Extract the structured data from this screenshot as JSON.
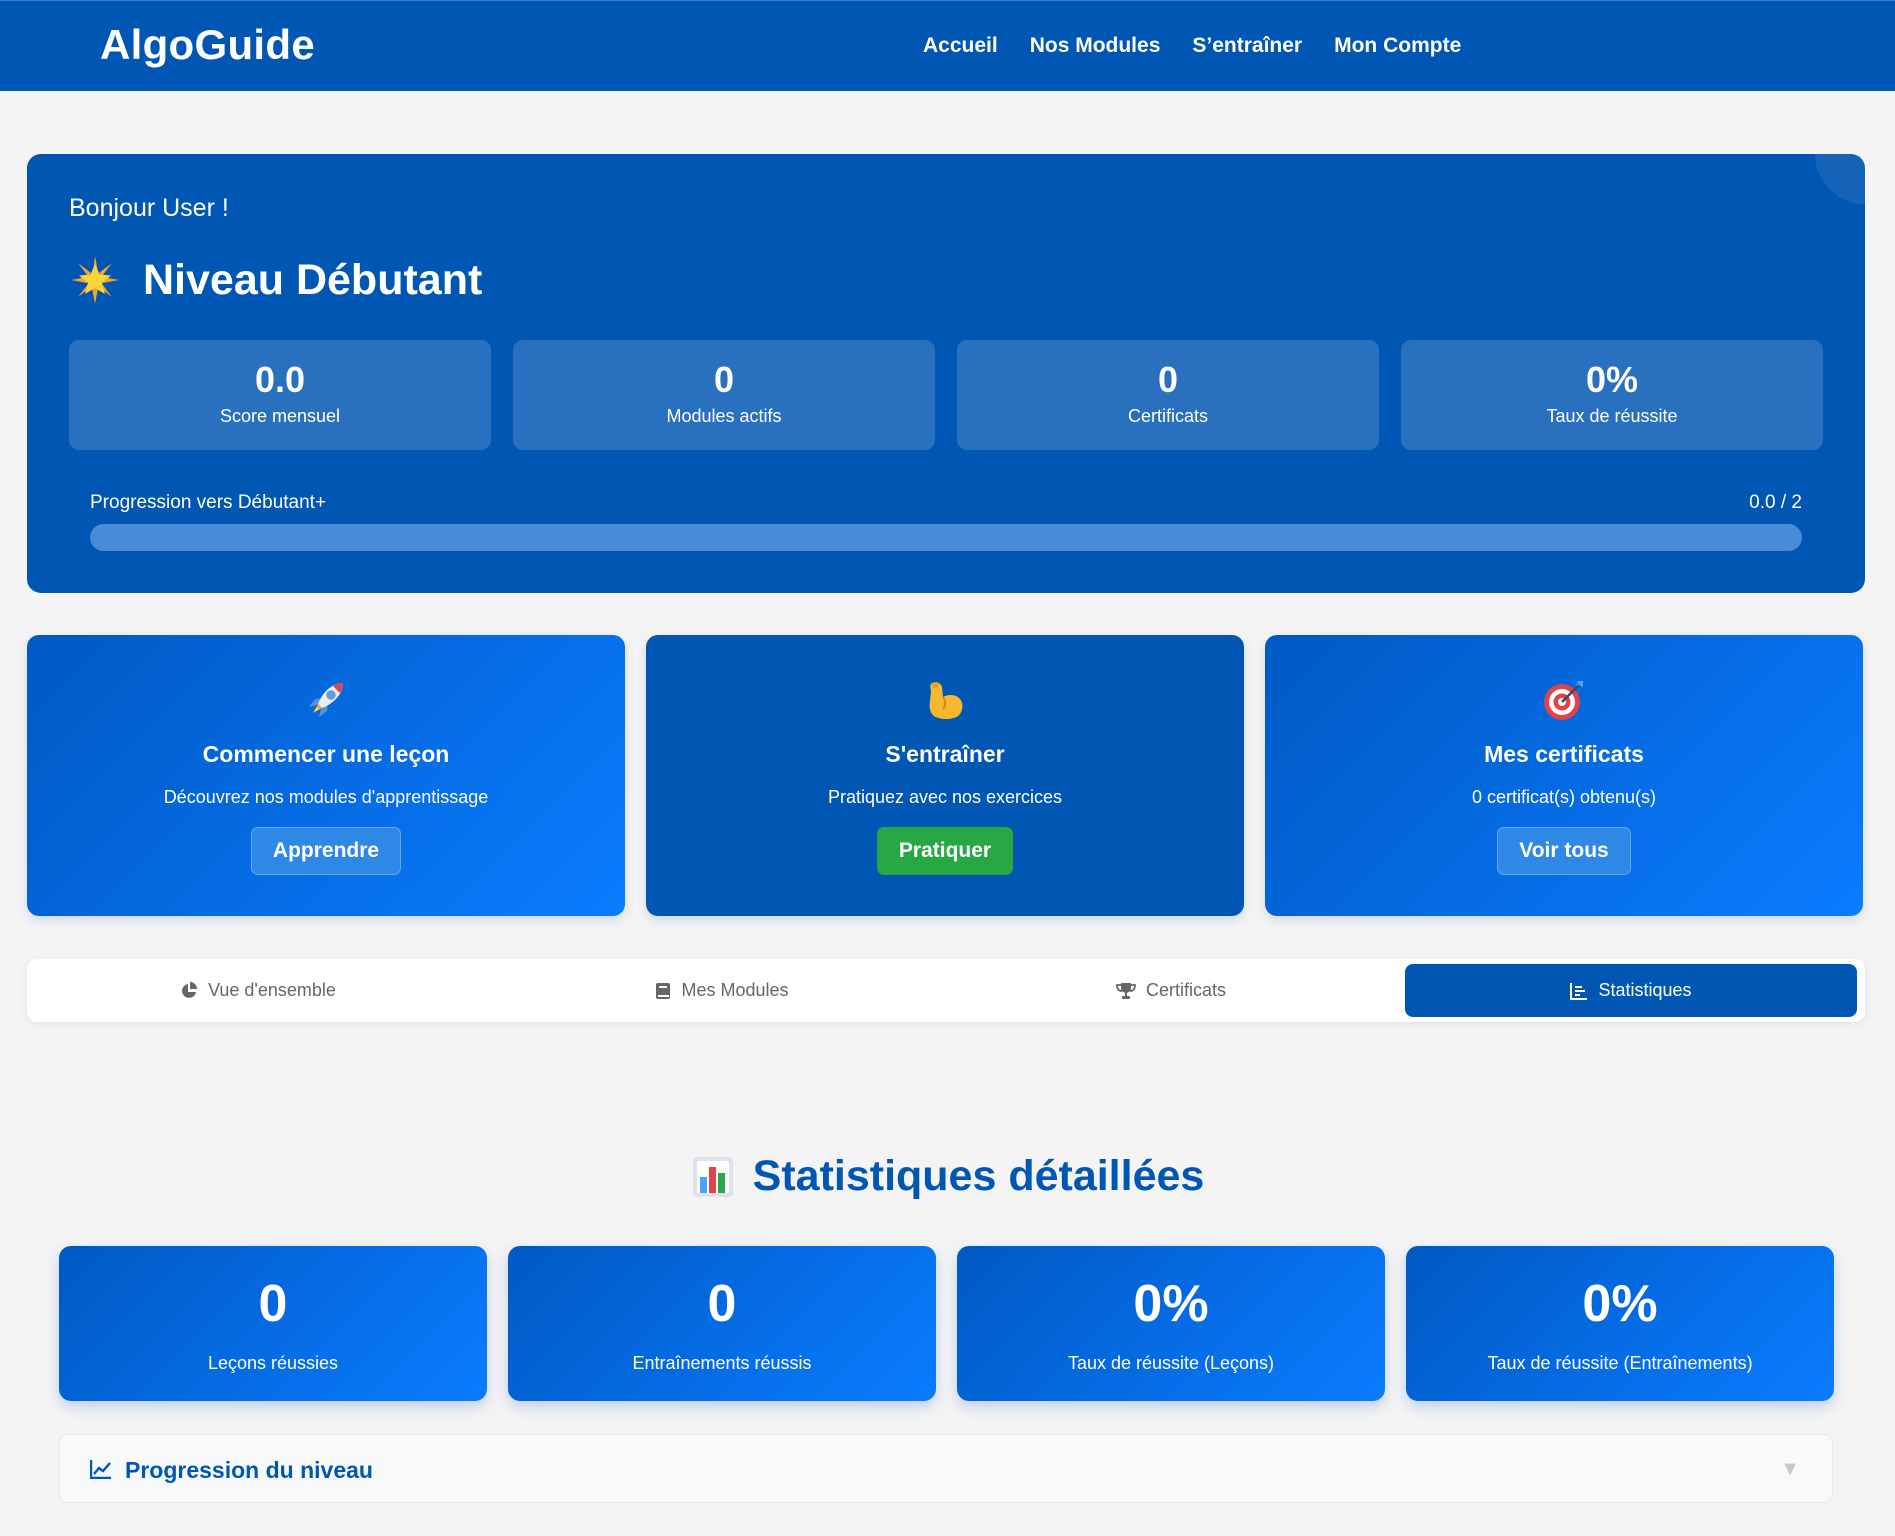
{
  "navbar": {
    "brand": "AlgoGuide",
    "links": [
      "Accueil",
      "Nos Modules",
      "S’entraîner",
      "Mon Compte"
    ]
  },
  "hero": {
    "greeting": "Bonjour User !",
    "level": "Niveau Débutant",
    "level_icon": "star-icon",
    "stats": [
      {
        "value": "0.0",
        "label": "Score mensuel"
      },
      {
        "value": "0",
        "label": "Modules actifs"
      },
      {
        "value": "0",
        "label": "Certificats"
      },
      {
        "value": "0%",
        "label": "Taux de réussite"
      }
    ],
    "progress_label": "Progression vers Débutant+",
    "progress_value": "0.0 / 2",
    "progress_fraction": 0
  },
  "actions": [
    {
      "icon": "rocket-icon",
      "title": "Commencer une leçon",
      "desc": "Découvrez nos modules d'apprentissage",
      "button": "Apprendre"
    },
    {
      "icon": "flexed-biceps-icon",
      "title": "S'entraîner",
      "desc": "Pratiquez avec nos exercices",
      "button": "Pratiquer"
    },
    {
      "icon": "target-icon",
      "title": "Mes certificats",
      "desc": "0 certificat(s) obtenu(s)",
      "button": "Voir tous"
    }
  ],
  "tabs": [
    {
      "icon": "pie-chart-icon",
      "label": "Vue d'ensemble",
      "active": false
    },
    {
      "icon": "book-icon",
      "label": "Mes Modules",
      "active": false
    },
    {
      "icon": "trophy-icon",
      "label": "Certificats",
      "active": false
    },
    {
      "icon": "bar-chart-icon",
      "label": "Statistiques",
      "active": true
    }
  ],
  "statistics": {
    "title": "Statistiques détaillées",
    "title_icon": "bar-chart-emoji-icon",
    "cards": [
      {
        "value": "0",
        "label": "Leçons réussies"
      },
      {
        "value": "0",
        "label": "Entraînements réussis"
      },
      {
        "value": "0%",
        "label": "Taux de réussite (Leçons)"
      },
      {
        "value": "0%",
        "label": "Taux de réussite (Entraînements)"
      }
    ],
    "accordion": {
      "title": "Progression du niveau",
      "icon": "line-chart-icon",
      "chevron": "▼"
    }
  },
  "colors": {
    "primary": "#0056b3",
    "accent": "#0a7cff",
    "success": "#28a745",
    "background": "#f4f4f5"
  }
}
